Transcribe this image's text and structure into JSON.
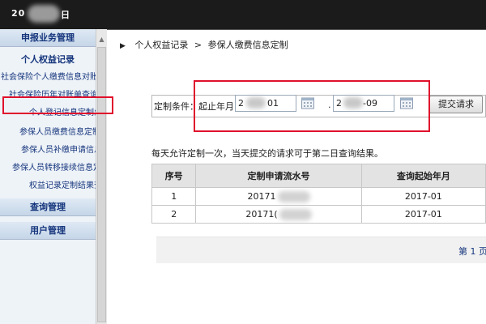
{
  "header": {
    "year_prefix": "20",
    "date_suffix": "日"
  },
  "sidebar": {
    "group_declare": "申报业务管理",
    "sub_personal": "个人权益记录",
    "items": [
      "社会保险个人缴费信息对账单",
      "社会保险历年对账单查询（",
      "个人登记信息定制业务",
      "参保人员缴费信息定制业",
      "参保人员补缴申请信息定制业",
      "参保人员转移接续信息定制",
      "权益记录定制结果查询"
    ],
    "group_query": "查询管理",
    "group_user": "用户管理"
  },
  "breadcrumb": {
    "part1": "个人权益记录",
    "separator": ">",
    "part2": "参保人缴费信息定制"
  },
  "form": {
    "label": "定制条件：起止年月",
    "start_prefix": "2",
    "start_suffix": "01",
    "separator": ".",
    "end_prefix": "2",
    "end_suffix": "-09",
    "submit_label": "提交请求"
  },
  "note": "每天允许定制一次，当天提交的请求可于第二日查询结果。",
  "table": {
    "headers": [
      "序号",
      "定制申请流水号",
      "查询起始年月"
    ],
    "rows": [
      {
        "num": "1",
        "flow": "20171",
        "month": "2017-01"
      },
      {
        "num": "2",
        "flow": "20171(",
        "month": "2017-01"
      }
    ]
  },
  "pager": {
    "text": "第 1 页"
  },
  "colors": {
    "highlight_red": "#e0102c",
    "nav_blue": "#16367d",
    "top_bar": "#1b1b1b"
  }
}
